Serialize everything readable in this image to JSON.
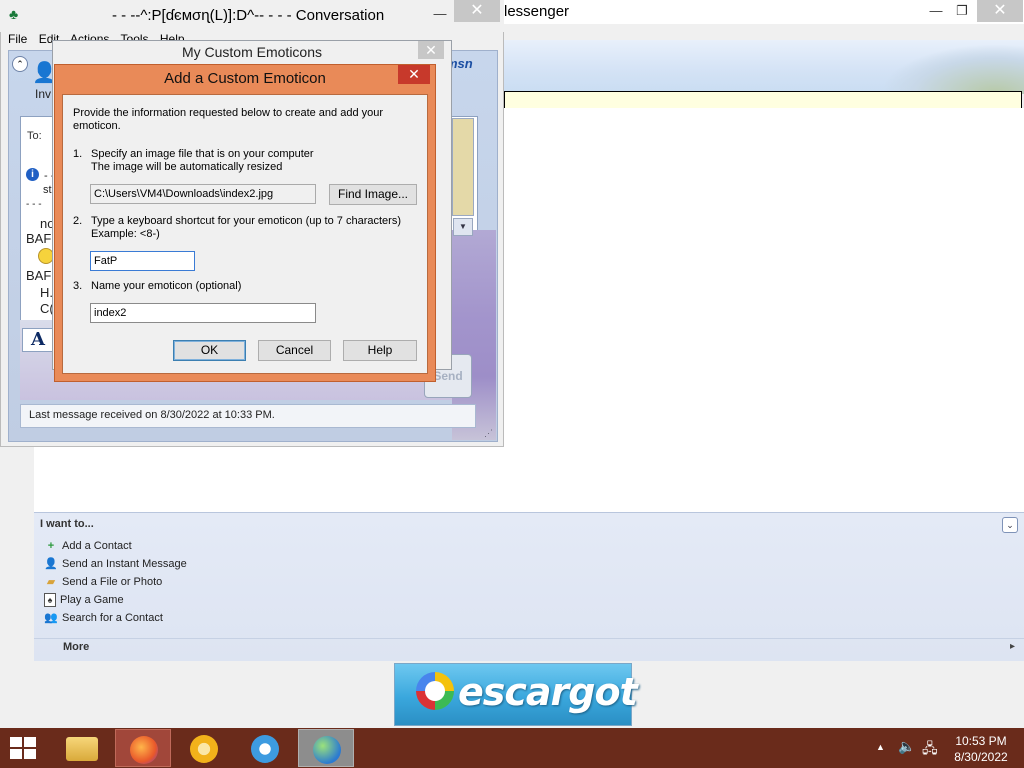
{
  "main_window": {
    "title": "lessenger",
    "tasks": {
      "header": "I want to...",
      "items": [
        {
          "label": "Add a Contact",
          "icon": "plus-icon"
        },
        {
          "label": "Send an Instant Message",
          "icon": "person-message-icon"
        },
        {
          "label": "Send a File or Photo",
          "icon": "folder-photo-icon"
        },
        {
          "label": "Play a Game",
          "icon": "game-card-icon"
        },
        {
          "label": "Search for a Contact",
          "icon": "search-contact-icon"
        }
      ],
      "more": "More"
    },
    "banner_text": "escargot"
  },
  "conversation": {
    "title": "- - --^:P[ɗємσɳ(L)]:D^-- - - - Conversation",
    "menus": [
      "File",
      "Edit",
      "Actions",
      "Tools",
      "Help"
    ],
    "invite_label": "Inv",
    "to_label": "To:",
    "brand": "msn",
    "side_text": [
      "- -",
      "st",
      "- - -",
      "no",
      "BAF",
      "BAF",
      "H.",
      "C("
    ],
    "font_label": "A",
    "send_label": "Send",
    "status": "Last message received on 8/30/2022 at 10:33 PM."
  },
  "emoticons_window": {
    "title": "My Custom Emoticons",
    "close": "✕"
  },
  "add_dialog": {
    "title": "Add a Custom Emoticon",
    "close": "✕",
    "intro": "Provide the information requested below to create and add your emoticon.",
    "step1_num": "1.",
    "step1_line1": "Specify an image file that is on your computer",
    "step1_line2": "The image will be automatically resized",
    "image_path": "C:\\Users\\VM4\\Downloads\\index2.jpg",
    "find_image_label": "Find Image...",
    "step2_num": "2.",
    "step2_line1": "Type a keyboard shortcut for your emoticon (up to 7 characters)",
    "step2_line2": "Example: <8-)",
    "shortcut_value": "FatP",
    "step3_num": "3.",
    "step3_line1": "Name your emoticon (optional)",
    "name_value": "index2",
    "ok_label": "OK",
    "cancel_label": "Cancel",
    "help_label": "Help"
  },
  "taskbar": {
    "apps": [
      {
        "name": "file-explorer-icon"
      },
      {
        "name": "firefox-icon"
      },
      {
        "name": "chrome-icon"
      },
      {
        "name": "internet-explorer-icon"
      },
      {
        "name": "messenger-icon"
      }
    ],
    "time": "10:53 PM",
    "date": "8/30/2022"
  },
  "colors": {
    "dialog_frame": "#e98a58",
    "taskbar": "#6a2b1b",
    "close_red": "#c7392b"
  }
}
